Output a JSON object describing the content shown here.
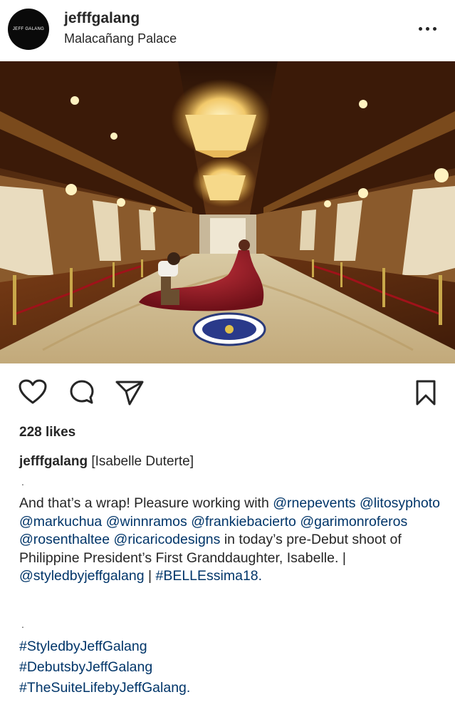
{
  "post": {
    "avatar_text": "JEFF GALANG",
    "username": "jefffgalang",
    "location": "Malacañang Palace"
  },
  "actions": {
    "like_icon": "heart-outline-icon",
    "comment_icon": "comment-bubble-icon",
    "share_icon": "paper-plane-icon",
    "save_icon": "bookmark-icon"
  },
  "likes": "228 likes",
  "caption": {
    "author": "jefffgalang",
    "head_text": "[Isabelle Duterte]",
    "separator": ".",
    "segments": [
      {
        "text": "And that’s a wrap! Pleasure working with",
        "link": false
      },
      {
        "text": "@rnepevents",
        "link": true
      },
      {
        "text": "@litosyphoto",
        "link": true
      },
      {
        "text": "@markuchua",
        "link": true
      },
      {
        "text": "@winnramos",
        "link": true
      },
      {
        "text": "@frankiebacierto",
        "link": true
      },
      {
        "text": "@garimonroferos",
        "link": true
      },
      {
        "text": "@rosenthaltee",
        "link": true
      },
      {
        "text": "@ricaricodesigns",
        "link": true
      },
      {
        "text": "in today’s pre-Debut shoot of Philippine President’s First Granddaughter, Isabelle. |",
        "link": false
      },
      {
        "text": "@styledbyjeffgalang",
        "link": true
      },
      {
        "text": "|",
        "link": false
      },
      {
        "text": "#BELLEssima18.",
        "link": true
      }
    ],
    "hashtags": [
      "#StyledbyJeffGalang",
      "#DebutsbyJeffGalang",
      "#TheSuiteLifebyJeffGalang."
    ]
  },
  "colors": {
    "text": "#262626",
    "link": "#003569",
    "gown": "#8e1a22",
    "carpet": "#c9b48a",
    "wood": "#5a2c12"
  }
}
